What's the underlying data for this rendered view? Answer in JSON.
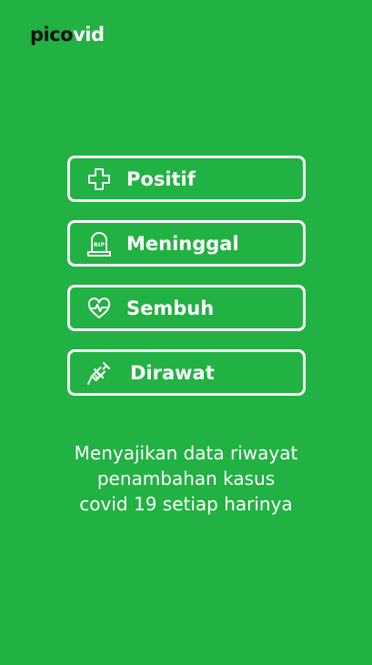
{
  "app": {
    "logo_part1": "pico",
    "logo_part2": "vid"
  },
  "menu": {
    "items": [
      {
        "label": "Positif",
        "icon": "plus-icon"
      },
      {
        "label": "Meninggal",
        "icon": "tombstone-icon",
        "icon_text": "RIP"
      },
      {
        "label": "Sembuh",
        "icon": "heart-pulse-icon"
      },
      {
        "label": "Dirawat",
        "icon": "syringe-icon"
      }
    ]
  },
  "tagline": {
    "lines": [
      "Menyajikan data riwayat",
      "penambahan kasus",
      "covid 19 setiap harinya"
    ]
  },
  "colors": {
    "background": "#22b143",
    "logo_dark": "#111111",
    "foreground": "#ffffff"
  }
}
